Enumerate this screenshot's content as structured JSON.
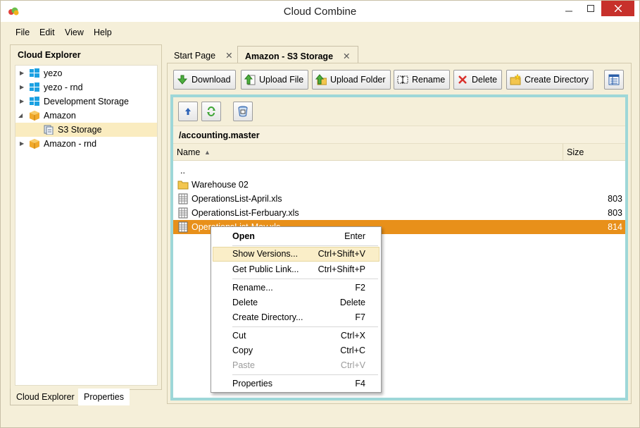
{
  "window": {
    "title": "Cloud Combine"
  },
  "menubar": [
    "File",
    "Edit",
    "View",
    "Help"
  ],
  "left_panel": {
    "title": "Cloud Explorer",
    "tree": [
      {
        "label": "yezo",
        "icon": "windows-azure-icon",
        "expander": "collapsed"
      },
      {
        "label": "yezo - rnd",
        "icon": "windows-azure-icon",
        "expander": "collapsed"
      },
      {
        "label": "Development Storage",
        "icon": "windows-azure-icon",
        "expander": "collapsed"
      },
      {
        "label": "Amazon",
        "icon": "amazon-box-icon",
        "expander": "expanded"
      },
      {
        "label": "S3 Storage",
        "icon": "s3-storage-icon",
        "expander": "none",
        "selected": true
      },
      {
        "label": "Amazon - rnd",
        "icon": "amazon-box-icon",
        "expander": "collapsed"
      }
    ],
    "tabs": [
      "Cloud Explorer",
      "Properties"
    ]
  },
  "doc_tabs": [
    {
      "label": "Start Page",
      "close": "✕"
    },
    {
      "label": "Amazon - S3 Storage",
      "close": "✕",
      "active": true
    }
  ],
  "toolbar": {
    "download": "Download",
    "upload_file": "Upload File",
    "upload_folder": "Upload Folder",
    "rename": "Rename",
    "delete": "Delete",
    "create_directory": "Create Directory"
  },
  "browser": {
    "path": "/accounting.master",
    "columns": {
      "name": "Name",
      "size": "Size"
    },
    "rows": [
      {
        "name": "..",
        "size": "",
        "icon": "none"
      },
      {
        "name": "Warehouse 02",
        "size": "",
        "icon": "folder-icon"
      },
      {
        "name": "OperationsList-April.xls",
        "size": "803",
        "icon": "spreadsheet-icon"
      },
      {
        "name": "OperationsList-Ferbuary.xls",
        "size": "803",
        "icon": "spreadsheet-icon"
      },
      {
        "name": "OperationsList-May.xls",
        "size": "814",
        "icon": "spreadsheet-icon",
        "selected": true
      }
    ]
  },
  "context_menu": [
    {
      "label": "Open",
      "key": "Enter",
      "bold": true
    },
    {
      "label": "Show Versions...",
      "key": "Ctrl+Shift+V",
      "highlighted": true
    },
    {
      "label": "Get Public Link...",
      "key": "Ctrl+Shift+P"
    },
    {
      "label": "Rename...",
      "key": "F2"
    },
    {
      "label": "Delete",
      "key": "Delete"
    },
    {
      "label": "Create Directory...",
      "key": "F7"
    },
    {
      "label": "Cut",
      "key": "Ctrl+X"
    },
    {
      "label": "Copy",
      "key": "Ctrl+C"
    },
    {
      "label": "Paste",
      "key": "Ctrl+V",
      "disabled": true
    },
    {
      "label": "Properties",
      "key": "F4"
    }
  ],
  "colors": {
    "selection": "#e8901a",
    "frame": "#9ed7d8",
    "chrome": "#f5efd9",
    "close": "#c7302b"
  }
}
